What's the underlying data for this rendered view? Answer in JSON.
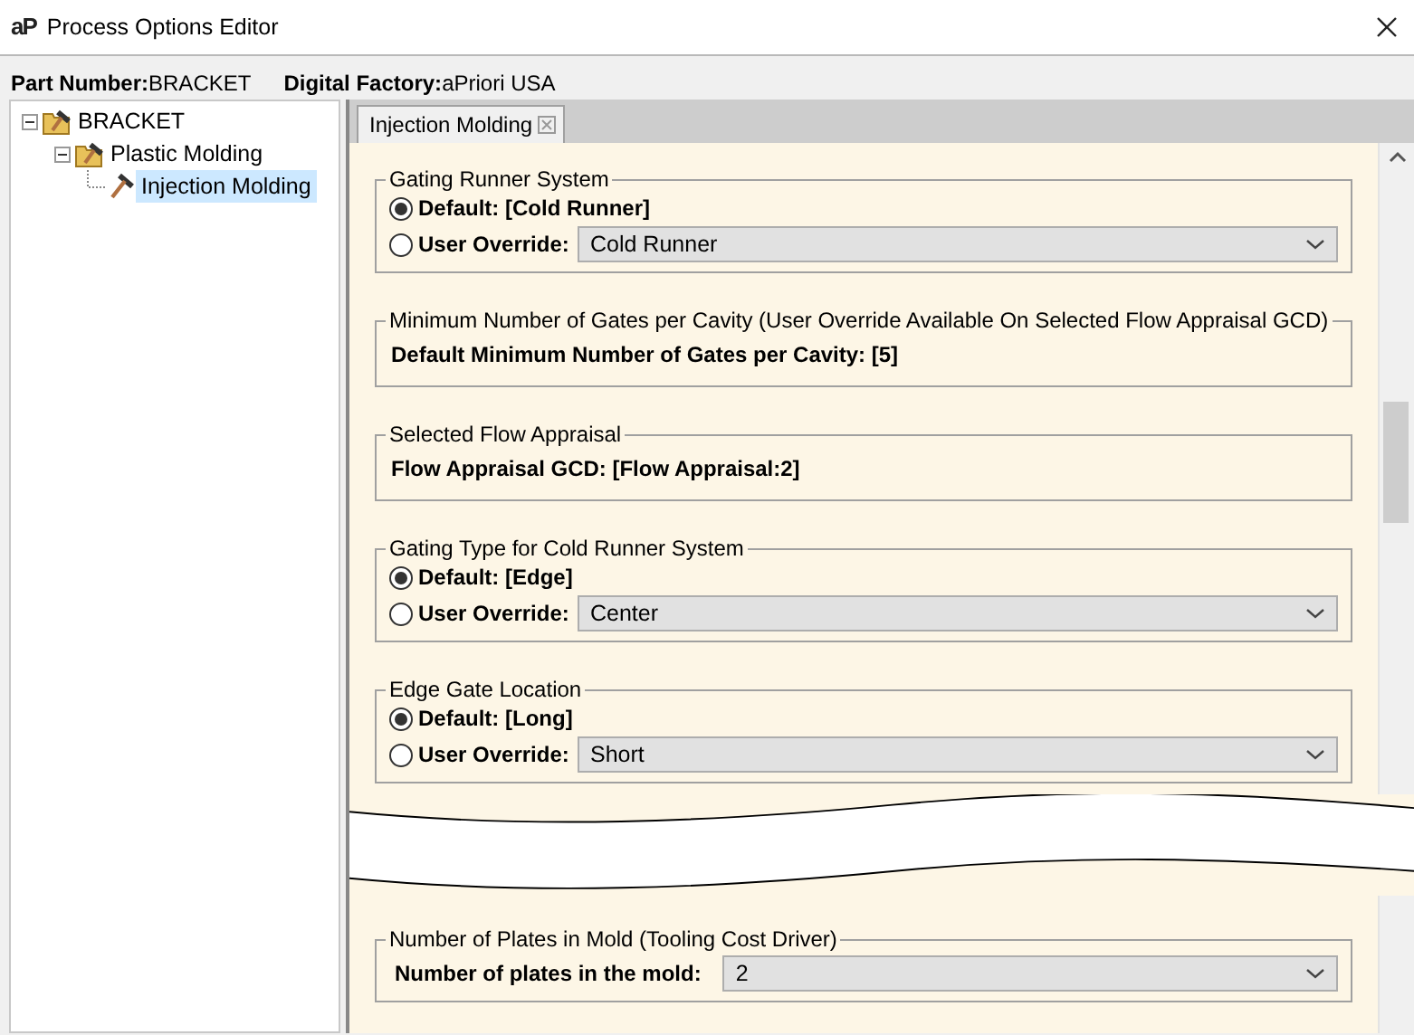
{
  "window": {
    "logo": "aP",
    "title": "Process Options Editor"
  },
  "header": {
    "part_number_label": "Part Number:",
    "part_number": "BRACKET",
    "factory_label": "Digital Factory:",
    "factory": "aPriori USA"
  },
  "tree": [
    {
      "label": "BRACKET",
      "expanded": true,
      "selected": false,
      "children": [
        {
          "label": "Plastic Molding",
          "expanded": true,
          "selected": false,
          "children": [
            {
              "label": "Injection Molding",
              "selected": true
            }
          ]
        }
      ]
    }
  ],
  "tabs": [
    {
      "label": "Injection Molding",
      "selected": true
    }
  ],
  "groups": [
    {
      "kind": "radio",
      "title": "Gating Runner System",
      "options": [
        {
          "label": "Default: [Cold Runner]",
          "selected": true
        },
        {
          "label": "User Override:",
          "selected": false
        }
      ],
      "override_value": "Cold Runner"
    },
    {
      "kind": "info",
      "title": "Minimum Number of Gates per Cavity (User Override Available On Selected Flow Appraisal GCD)",
      "text": "Default Minimum Number of Gates per Cavity: [5]"
    },
    {
      "kind": "info",
      "title": "Selected Flow Appraisal",
      "text": "Flow Appraisal GCD: [Flow Appraisal:2]"
    },
    {
      "kind": "radio",
      "title": "Gating Type for Cold Runner System",
      "options": [
        {
          "label": "Default: [Edge]",
          "selected": true
        },
        {
          "label": "User Override:",
          "selected": false
        }
      ],
      "override_value": "Center"
    },
    {
      "kind": "radio",
      "title": "Edge Gate Location",
      "options": [
        {
          "label": "Default: [Long]",
          "selected": true
        },
        {
          "label": "User Override:",
          "selected": false
        }
      ],
      "override_value": "Short"
    }
  ],
  "groups_after_break": [
    {
      "kind": "select",
      "title": "Number of Plates in Mold (Tooling Cost Driver)",
      "label": "Number of plates in the mold:",
      "value": "2"
    }
  ]
}
